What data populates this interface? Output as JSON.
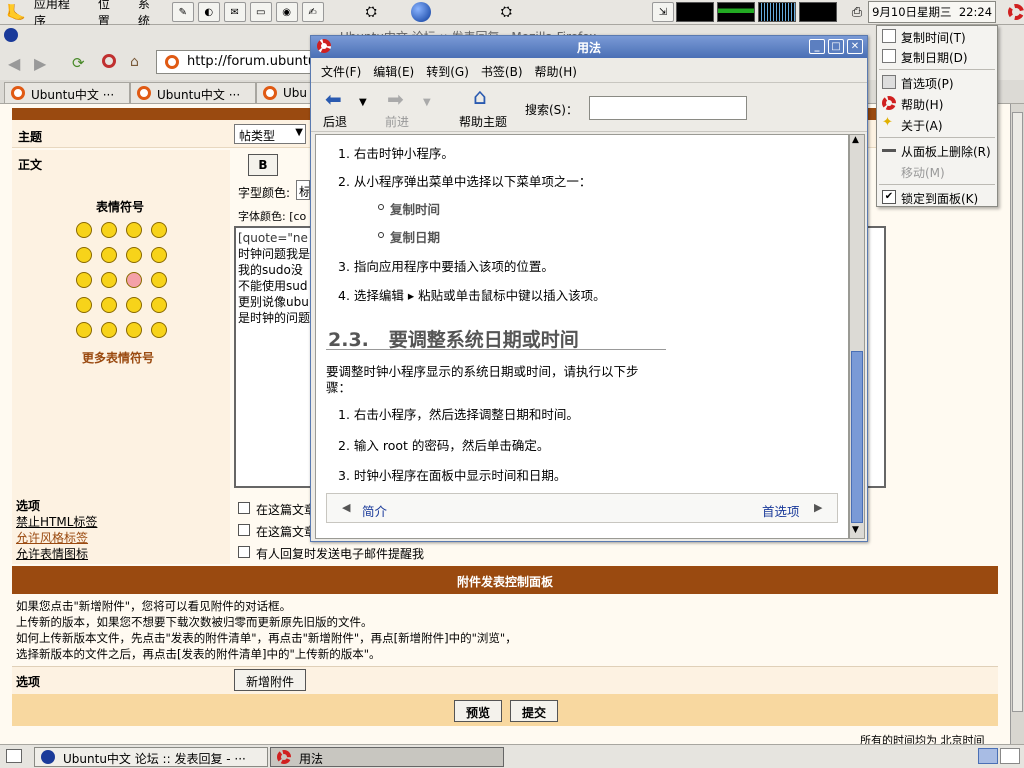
{
  "panel": {
    "menus": [
      "应用程序",
      "位置",
      "系统"
    ],
    "clock": "9月10日星期三  22:24"
  },
  "firefox": {
    "url": "http://forum.ubuntu",
    "title_partial": "Ubuntu中文 论坛 :: 发表回复 - Mozilla Firefox",
    "tabs": [
      "Ubuntu中文 ···",
      "Ubuntu中文 ···",
      "Ubu"
    ]
  },
  "form": {
    "subject_label": "主题",
    "type_select": "帖类型",
    "body_label": "正文",
    "emoticons_title": "表情符号",
    "more_emoticons": "更多表情符号",
    "bold_btn": "B",
    "font_color_label": "字型颜色:",
    "font_color_value": "标",
    "font_size_label": "字体颜色: [co",
    "text_lines": [
      "[quote=\"ne",
      "时钟问题我是",
      "我的sudo没",
      "不能使用sud",
      "更别说像ubu",
      "是时钟的问题"
    ],
    "options_label": "选项",
    "opt_links": [
      "禁止HTML标签",
      "允许风格标签",
      "允许表情图标"
    ],
    "checkboxes": [
      "在这篇文章",
      "在这篇文章",
      "有人回复时发送电子邮件提醒我"
    ],
    "attach_title": "附件发表控制面板",
    "attach_text": [
      "如果您点击\"新增附件\"，您将可以看见附件的对话框。",
      "上传新的版本，如果您不想要下载次数被归零而更新原先旧版的文件。",
      "如何上传新版本文件，先点击\"发表的附件清单\"，再点击\"新增附件\"，再点[新增附件]中的\"浏览\"，",
      "选择新版本的文件之后，再点击[发表的附件清单]中的\"上传新的版本\"。"
    ],
    "attach_option_label": "选项",
    "add_attach_btn": "新增附件",
    "preview_btn": "预览",
    "submit_btn": "提交",
    "footer_text": "所有的时间均为 北京时间"
  },
  "help": {
    "title": "用法",
    "menu": [
      "文件(F)",
      "编辑(E)",
      "转到(G)",
      "书签(B)",
      "帮助(H)"
    ],
    "back": "后退",
    "forward": "前进",
    "help_topics": "帮助主题",
    "search_label": "搜索(S)：",
    "search_value": "",
    "items1": [
      "1.  右击时钟小程序。",
      "2.  从小程序弹出菜单中选择以下菜单项之一：",
      "复制时间",
      "复制日期",
      "3.  指向应用程序中要插入该项的位置。",
      "4.  选择编辑 ▸ 粘贴或单击鼠标中键以插入该项。"
    ],
    "section": "2.3.   要调整系统日期或时间",
    "intro": [
      "要调整时钟小程序显示的系统日期或时间，请执行以下步",
      "骤："
    ],
    "items2": [
      "1.  右击小程序，然后选择调整日期和时间。",
      "2.  输入 root 的密码，然后单击确定。",
      "3.  时钟小程序在面板中显示时间和日期。"
    ],
    "nav_prev": "简介",
    "nav_next": "首选项"
  },
  "context_menu": {
    "items": [
      "复制时间(T)",
      "复制日期(D)",
      "首选项(P)",
      "帮助(H)",
      "关于(A)",
      "从面板上删除(R)",
      "移动(M)",
      "锁定到面板(K)"
    ]
  },
  "taskbar": {
    "tasks": [
      "Ubuntu中文 论坛 :: 发表回复 - ···",
      "用法"
    ]
  },
  "colors": {
    "forum_header": "#9a4a10",
    "link": "#1a3a9a",
    "title_bar": "#4a6fb5"
  }
}
